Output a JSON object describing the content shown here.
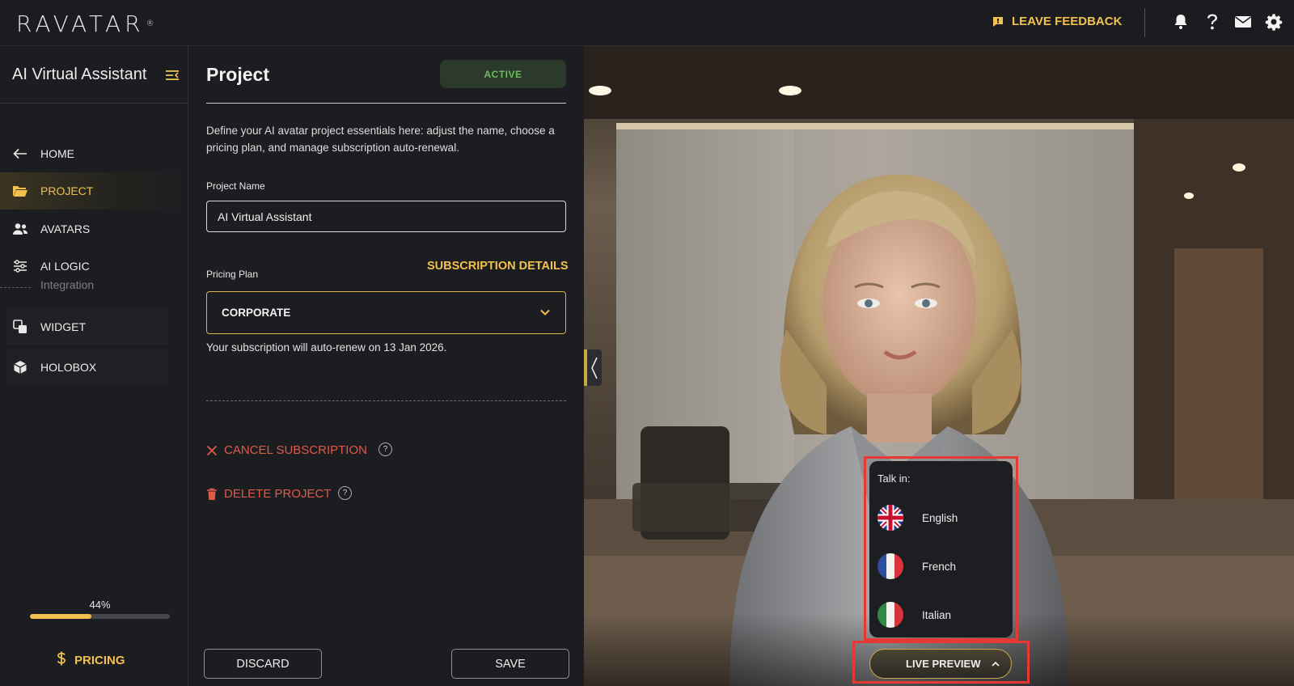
{
  "app": {
    "logo_text": "RAVATAR",
    "logo_mark": "®"
  },
  "topbar": {
    "feedback_label": "LEAVE FEEDBACK"
  },
  "sidebar": {
    "title": "AI Virtual Assistant",
    "items": [
      {
        "label": "HOME"
      },
      {
        "label": "PROJECT"
      },
      {
        "label": "AVATARS"
      },
      {
        "label": "AI LOGIC"
      }
    ],
    "integration_label": "Integration",
    "integration_items": [
      {
        "label": "WIDGET"
      },
      {
        "label": "HOLOBOX"
      }
    ],
    "progress": {
      "label": "44%",
      "value": 0.44
    },
    "pricing_label": "PRICING"
  },
  "project": {
    "title": "Project",
    "status": "ACTIVE",
    "description": "Define your AI avatar project essentials here: adjust the name, choose a pricing plan, and manage subscription auto-renewal.",
    "name_label": "Project Name",
    "name_value": "AI Virtual Assistant",
    "plan_label": "Pricing Plan",
    "subscription_details_label": "SUBSCRIPTION DETAILS",
    "plan_value": "CORPORATE",
    "renew_text": "Your subscription will auto-renew on 13 Jan 2026.",
    "cancel_label": "CANCEL SUBSCRIPTION",
    "delete_label": "DELETE PROJECT",
    "help_glyph": "?",
    "discard_label": "DISCARD",
    "save_label": "SAVE"
  },
  "preview": {
    "talk_in_label": "Talk in:",
    "languages": [
      {
        "name": "English",
        "flag": "uk-flag"
      },
      {
        "name": "French",
        "flag": "france-flag"
      },
      {
        "name": "Italian",
        "flag": "italy-flag"
      }
    ],
    "live_preview_label": "LIVE PREVIEW"
  },
  "colors": {
    "accent": "#f2c14e",
    "danger": "#e05a4a",
    "active_badge_text": "#6dbb5f",
    "highlight": "#e53935"
  }
}
